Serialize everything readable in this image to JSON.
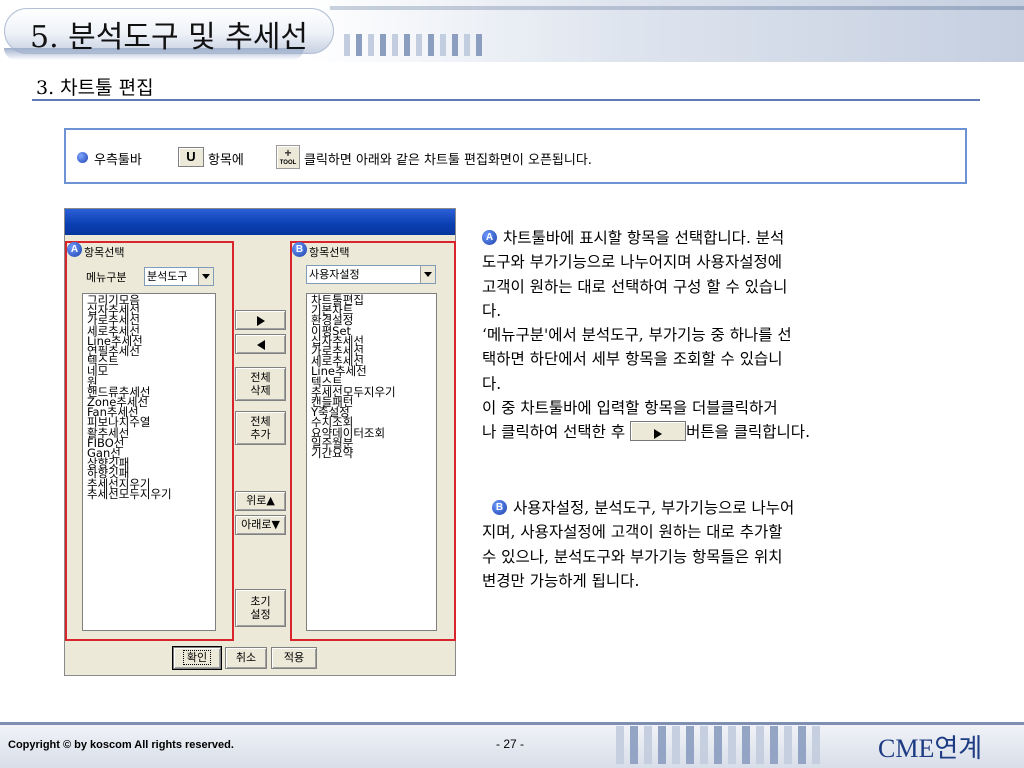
{
  "header": {
    "title": "5. 분석도구 및 추세선",
    "subtitle": "3. 차트툴 편집"
  },
  "instruction": {
    "text_before": "우측툴바",
    "u_button": "U",
    "text_middle": "항목에",
    "tool_button": "TOOL",
    "text_after": "클릭하면 아래와 같은 차트툴 편집화면이 오픈됩니다."
  },
  "dialog": {
    "panel_a": {
      "badge": "A",
      "label": "항목선택",
      "menu_label": "메뉴구분",
      "menu_value": "분석도구",
      "items": [
        "그리기모음",
        "십자추세선",
        "가로추세선",
        "세로추세선",
        "Line추세선",
        "연필추세선",
        "텍스트",
        "네모",
        "원",
        "핸드류추세선",
        "Zone추세선",
        "Fan추세선",
        "피보나치수열",
        "활추세선",
        "FIBO선",
        "Gan선",
        "상향깃패",
        "하향깃패",
        "추세선지우기",
        "추세선모두지우기"
      ]
    },
    "panel_b": {
      "badge": "B",
      "label": "항목선택",
      "combo_value": "사용자설정",
      "items": [
        "차트툴편집",
        "기본차트",
        "환경설정",
        "이평Set",
        "십자추세선",
        "가로추세선",
        "세로추세선",
        "Line추세선",
        "텍스트",
        "추세선모두지우기",
        "캔들패턴",
        "Y축설정",
        "수치조회",
        "요약데이터조회",
        "일주월분",
        "기간요약"
      ]
    },
    "buttons": {
      "delete_all": "전체\n삭제",
      "add_all": "전체\n추가",
      "up": "위로▲",
      "down": "아래로▼",
      "reset": "초기\n설정",
      "ok": "확인",
      "cancel": "취소",
      "apply": "적용"
    }
  },
  "description": {
    "a_badge": "A",
    "a_lines": [
      "차트툴바에 표시할 항목을 선택합니다. 분석",
      "도구와 부가기능으로 나누어지며 사용자설정에",
      "고객이 원하는 대로 선택하여 구성 할 수 있습니",
      "다.",
      "‘메뉴구분'에서 분석도구, 부가기능 중 하나를 선",
      "택하면 하단에서 세부 항목을 조회할 수 있습니",
      "다.",
      "이 중 차트툴바에 입력할 항목을 더블클릭하거"
    ],
    "a_last_before": "나 클릭하여 선택한 후",
    "a_last_after": "버튼을 클릭합니다.",
    "b_badge": "B",
    "b_lines": [
      "사용자설정, 분석도구, 부가기능으로 나누어",
      "지며, 사용자설정에 고객이 원하는 대로 추가할",
      "수 있으나, 분석도구와 부가기능 항목들은 위치",
      "변경만 가능하게 됩니다."
    ]
  },
  "footer": {
    "copyright": "Copyright © by koscom All rights reserved.",
    "page": "- 27 -",
    "brand": "CME연계"
  },
  "colors": {
    "accent_blue": "#6e93d4",
    "highlight_red": "#d8242a",
    "brand_navy": "#1d3c84"
  }
}
